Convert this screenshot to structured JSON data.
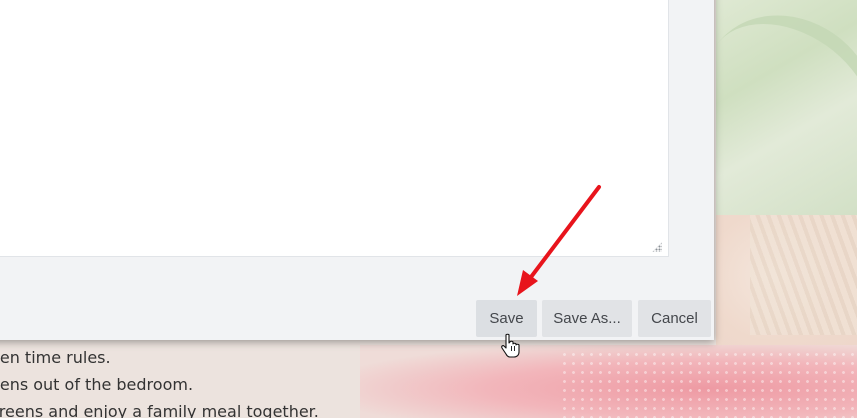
{
  "background": {
    "lines": [
      "een time rules.",
      "eens out of the bedroom.",
      "creens and enjoy a family meal together."
    ]
  },
  "dialog": {
    "buttons": {
      "save_label": "Save",
      "save_as_label": "Save As...",
      "cancel_label": "Cancel"
    }
  },
  "colors": {
    "arrow": "#e8141c",
    "dialog_bg": "#f2f3f5",
    "button_bg": "#dcdfe3"
  },
  "icons": [
    "resize-grip-icon",
    "hand-pointer-cursor-icon",
    "red-arrow-annotation-icon"
  ]
}
